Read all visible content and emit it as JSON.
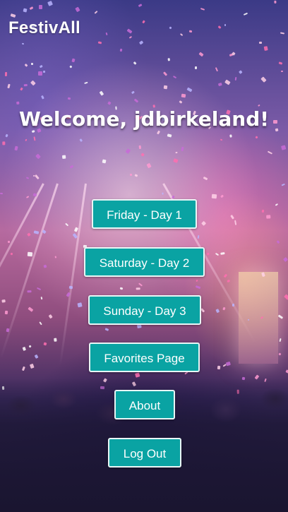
{
  "header": {
    "brand": "FestivAll"
  },
  "main": {
    "welcome": "Welcome, jdbirkeland!",
    "buttons": [
      {
        "label": "Friday - Day 1"
      },
      {
        "label": "Saturday - Day 2"
      },
      {
        "label": "Sunday - Day 3"
      },
      {
        "label": "Favorites Page"
      },
      {
        "label": "About"
      },
      {
        "label": "Log Out"
      }
    ]
  },
  "colors": {
    "button_bg": "#0aa3a3",
    "button_text": "#ffffff",
    "heading_text": "#ffffff"
  }
}
